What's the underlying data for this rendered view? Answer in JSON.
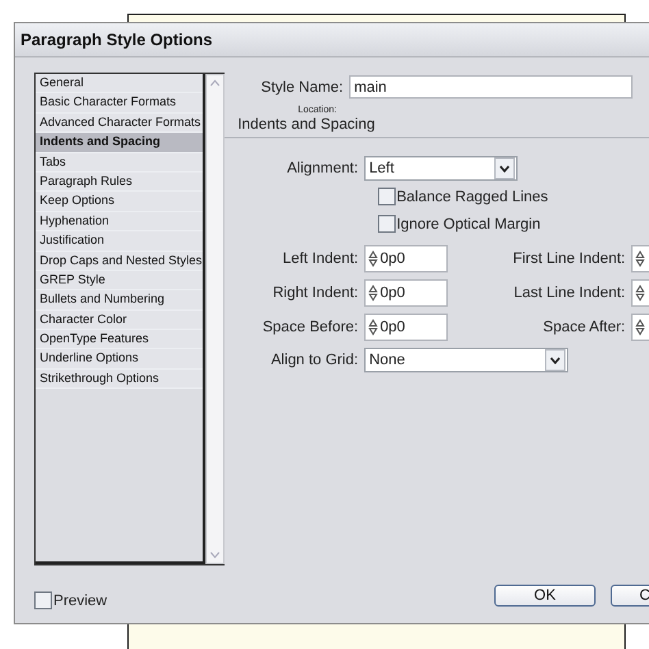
{
  "window": {
    "title": "Paragraph Style Options"
  },
  "sidebar": {
    "items": [
      {
        "label": "General",
        "selected": false
      },
      {
        "label": "Basic Character Formats",
        "selected": false
      },
      {
        "label": "Advanced Character Formats",
        "selected": false
      },
      {
        "label": "Indents and Spacing",
        "selected": true
      },
      {
        "label": "Tabs",
        "selected": false
      },
      {
        "label": "Paragraph Rules",
        "selected": false
      },
      {
        "label": "Keep Options",
        "selected": false
      },
      {
        "label": "Hyphenation",
        "selected": false
      },
      {
        "label": "Justification",
        "selected": false
      },
      {
        "label": "Drop Caps and Nested Styles",
        "selected": false
      },
      {
        "label": "GREP Style",
        "selected": false
      },
      {
        "label": "Bullets and Numbering",
        "selected": false
      },
      {
        "label": "Character Color",
        "selected": false
      },
      {
        "label": "OpenType Features",
        "selected": false
      },
      {
        "label": "Underline Options",
        "selected": false
      },
      {
        "label": "Strikethrough Options",
        "selected": false
      }
    ]
  },
  "style_name": {
    "label": "Style Name:",
    "value": "main"
  },
  "location": {
    "label": "Location:",
    "value": "Indents and Spacing"
  },
  "alignment": {
    "label": "Alignment:",
    "value": "Left"
  },
  "checkboxes": [
    {
      "label": "Balance Ragged Lines",
      "checked": false
    },
    {
      "label": "Ignore Optical Margin",
      "checked": false
    }
  ],
  "indents": [
    {
      "left_label": "Left Indent:",
      "left_value": "0p0",
      "right_label": "First Line Indent:"
    },
    {
      "left_label": "Right Indent:",
      "left_value": "0p0",
      "right_label": "Last Line Indent:"
    },
    {
      "left_label": "Space Before:",
      "left_value": "0p0",
      "right_label": "Space After:"
    }
  ],
  "align_to_grid": {
    "label": "Align to Grid:",
    "value": "None"
  },
  "preview": {
    "label": "Preview",
    "checked": false
  },
  "buttons": [
    "OK",
    "C"
  ]
}
